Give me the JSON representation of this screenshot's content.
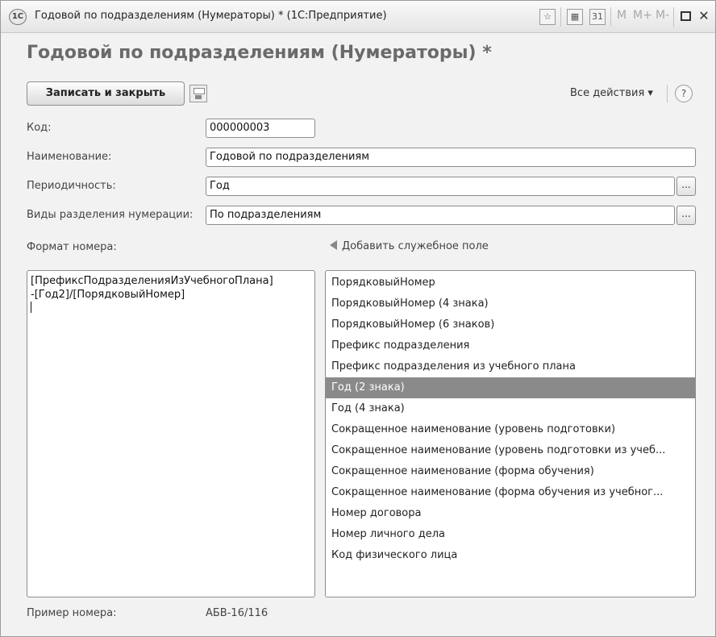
{
  "window": {
    "app_logo": "1С",
    "title": "Годовой по подразделениям (Нумераторы) * (1С:Предприятие)",
    "toolbar": {
      "favorites_icon": "star-icon",
      "calculator_icon": "calculator-icon",
      "calendar_icon": "calendar-icon",
      "calendar_text": "31",
      "m_label": "M",
      "m_plus_label": "M+",
      "m_minus_label": "M-",
      "maximize_icon": "maximize-icon",
      "close_glyph": "✕"
    }
  },
  "form": {
    "title": "Годовой по подразделениям (Нумераторы) *",
    "save_close_label": "Записать и закрыть",
    "save_icon": "floppy-disk-icon",
    "all_actions_label": "Все действия ▾",
    "help_label": "?"
  },
  "fields": {
    "code_label": "Код:",
    "code_value": "000000003",
    "name_label": "Наименование:",
    "name_value": "Годовой по подразделениям",
    "period_label": "Периодичность:",
    "period_value": "Год",
    "division_label": "Виды разделения нумерации:",
    "division_value": "По подразделениям",
    "select_button": "..."
  },
  "format": {
    "label": "Формат номера:",
    "line1": "[ПрефиксПодразделенияИзУчебногоПлана]",
    "line2": "-[Год2]/[ПорядковыйНомер]"
  },
  "service_fields": {
    "add_label": "Добавить служебное поле",
    "items": [
      "ПорядковыйНомер",
      "ПорядковыйНомер (4 знака)",
      "ПорядковыйНомер (6 знаков)",
      "Префикс подразделения",
      "Префикс подразделения из учебного плана",
      "Год (2 знака)",
      "Год (4 знака)",
      "Сокращенное наименование (уровень подготовки)",
      "Сокращенное наименование (уровень подготовки из учеб...",
      "Сокращенное наименование (форма обучения)",
      "Сокращенное наименование (форма обучения из учебног...",
      "Номер договора",
      "Номер личного дела",
      "Код физического лица"
    ],
    "selected_index": 5
  },
  "sample": {
    "label": "Пример номера:",
    "value": "АБВ-16/116"
  },
  "colors": {
    "selection": "#8a8a8a",
    "title_text": "#6a6a6a",
    "window_bg": "#f2f2f2"
  }
}
